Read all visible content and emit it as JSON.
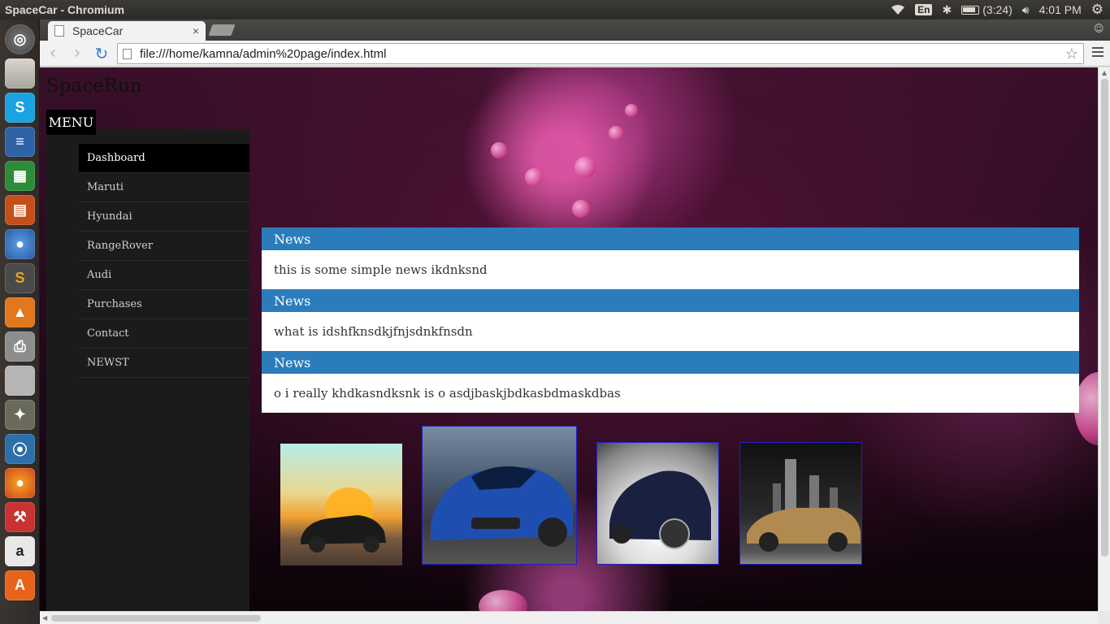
{
  "os_panel": {
    "window_title": "SpaceCar - Chromium",
    "language": "En",
    "battery": "(3:24)",
    "clock": "4:01 PM"
  },
  "browser": {
    "tab_title": "SpaceCar",
    "tab_close": "×",
    "url": "file:///home/kamna/admin%20page/index.html"
  },
  "page": {
    "site_title": "SpaceRun",
    "menu_label": "MENU",
    "sidebar": [
      {
        "label": "Dashboard"
      },
      {
        "label": "Maruti"
      },
      {
        "label": "Hyundai"
      },
      {
        "label": "RangeRover"
      },
      {
        "label": "Audi"
      },
      {
        "label": "Purchases"
      },
      {
        "label": "Contact"
      },
      {
        "label": "NEWST"
      }
    ],
    "news": [
      {
        "heading": "News",
        "text": "this is some simple news ikdnksnd"
      },
      {
        "heading": "News",
        "text": "what is idshfknsdkjfnjsdnkfnsdn"
      },
      {
        "heading": "News",
        "text": "o i really khdkasndksnk is o asdjbaskjbdkasbdmaskdbas"
      }
    ]
  },
  "colors": {
    "news_header": "#2b7cbb",
    "sidebar_bg": "#1b1b1b",
    "active_item": "#000000",
    "image_frame": "#2020c8"
  }
}
